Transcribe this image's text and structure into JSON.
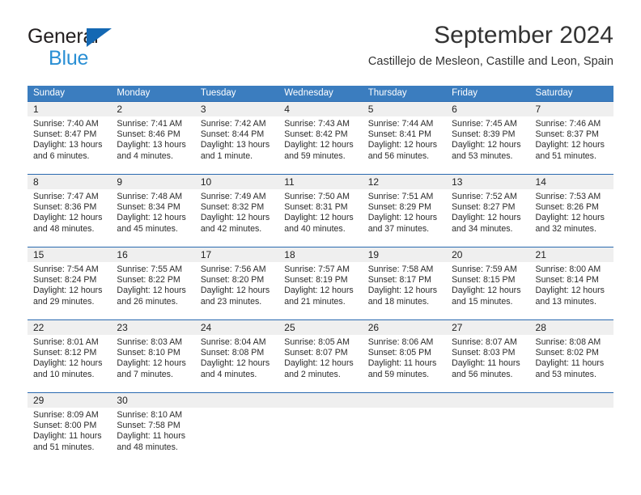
{
  "brand": {
    "line1": "General",
    "line2": "Blue",
    "triangle_color": "#1468b3",
    "line2_color": "#2a8fd4"
  },
  "header": {
    "title": "September 2024",
    "subtitle": "Castillejo de Mesleon, Castille and Leon, Spain"
  },
  "theme": {
    "header_bg": "#3b7dbf",
    "week_rule": "#2a6ab0",
    "daynum_band": "#efefef",
    "text": "#222222"
  },
  "weekdays": [
    "Sunday",
    "Monday",
    "Tuesday",
    "Wednesday",
    "Thursday",
    "Friday",
    "Saturday"
  ],
  "weeks": [
    {
      "days": [
        {
          "num": "1",
          "sunrise": "Sunrise: 7:40 AM",
          "sunset": "Sunset: 8:47 PM",
          "daylight_line1": "Daylight: 13 hours",
          "daylight_line2": "and 6 minutes."
        },
        {
          "num": "2",
          "sunrise": "Sunrise: 7:41 AM",
          "sunset": "Sunset: 8:46 PM",
          "daylight_line1": "Daylight: 13 hours",
          "daylight_line2": "and 4 minutes."
        },
        {
          "num": "3",
          "sunrise": "Sunrise: 7:42 AM",
          "sunset": "Sunset: 8:44 PM",
          "daylight_line1": "Daylight: 13 hours",
          "daylight_line2": "and 1 minute."
        },
        {
          "num": "4",
          "sunrise": "Sunrise: 7:43 AM",
          "sunset": "Sunset: 8:42 PM",
          "daylight_line1": "Daylight: 12 hours",
          "daylight_line2": "and 59 minutes."
        },
        {
          "num": "5",
          "sunrise": "Sunrise: 7:44 AM",
          "sunset": "Sunset: 8:41 PM",
          "daylight_line1": "Daylight: 12 hours",
          "daylight_line2": "and 56 minutes."
        },
        {
          "num": "6",
          "sunrise": "Sunrise: 7:45 AM",
          "sunset": "Sunset: 8:39 PM",
          "daylight_line1": "Daylight: 12 hours",
          "daylight_line2": "and 53 minutes."
        },
        {
          "num": "7",
          "sunrise": "Sunrise: 7:46 AM",
          "sunset": "Sunset: 8:37 PM",
          "daylight_line1": "Daylight: 12 hours",
          "daylight_line2": "and 51 minutes."
        }
      ]
    },
    {
      "days": [
        {
          "num": "8",
          "sunrise": "Sunrise: 7:47 AM",
          "sunset": "Sunset: 8:36 PM",
          "daylight_line1": "Daylight: 12 hours",
          "daylight_line2": "and 48 minutes."
        },
        {
          "num": "9",
          "sunrise": "Sunrise: 7:48 AM",
          "sunset": "Sunset: 8:34 PM",
          "daylight_line1": "Daylight: 12 hours",
          "daylight_line2": "and 45 minutes."
        },
        {
          "num": "10",
          "sunrise": "Sunrise: 7:49 AM",
          "sunset": "Sunset: 8:32 PM",
          "daylight_line1": "Daylight: 12 hours",
          "daylight_line2": "and 42 minutes."
        },
        {
          "num": "11",
          "sunrise": "Sunrise: 7:50 AM",
          "sunset": "Sunset: 8:31 PM",
          "daylight_line1": "Daylight: 12 hours",
          "daylight_line2": "and 40 minutes."
        },
        {
          "num": "12",
          "sunrise": "Sunrise: 7:51 AM",
          "sunset": "Sunset: 8:29 PM",
          "daylight_line1": "Daylight: 12 hours",
          "daylight_line2": "and 37 minutes."
        },
        {
          "num": "13",
          "sunrise": "Sunrise: 7:52 AM",
          "sunset": "Sunset: 8:27 PM",
          "daylight_line1": "Daylight: 12 hours",
          "daylight_line2": "and 34 minutes."
        },
        {
          "num": "14",
          "sunrise": "Sunrise: 7:53 AM",
          "sunset": "Sunset: 8:26 PM",
          "daylight_line1": "Daylight: 12 hours",
          "daylight_line2": "and 32 minutes."
        }
      ]
    },
    {
      "days": [
        {
          "num": "15",
          "sunrise": "Sunrise: 7:54 AM",
          "sunset": "Sunset: 8:24 PM",
          "daylight_line1": "Daylight: 12 hours",
          "daylight_line2": "and 29 minutes."
        },
        {
          "num": "16",
          "sunrise": "Sunrise: 7:55 AM",
          "sunset": "Sunset: 8:22 PM",
          "daylight_line1": "Daylight: 12 hours",
          "daylight_line2": "and 26 minutes."
        },
        {
          "num": "17",
          "sunrise": "Sunrise: 7:56 AM",
          "sunset": "Sunset: 8:20 PM",
          "daylight_line1": "Daylight: 12 hours",
          "daylight_line2": "and 23 minutes."
        },
        {
          "num": "18",
          "sunrise": "Sunrise: 7:57 AM",
          "sunset": "Sunset: 8:19 PM",
          "daylight_line1": "Daylight: 12 hours",
          "daylight_line2": "and 21 minutes."
        },
        {
          "num": "19",
          "sunrise": "Sunrise: 7:58 AM",
          "sunset": "Sunset: 8:17 PM",
          "daylight_line1": "Daylight: 12 hours",
          "daylight_line2": "and 18 minutes."
        },
        {
          "num": "20",
          "sunrise": "Sunrise: 7:59 AM",
          "sunset": "Sunset: 8:15 PM",
          "daylight_line1": "Daylight: 12 hours",
          "daylight_line2": "and 15 minutes."
        },
        {
          "num": "21",
          "sunrise": "Sunrise: 8:00 AM",
          "sunset": "Sunset: 8:14 PM",
          "daylight_line1": "Daylight: 12 hours",
          "daylight_line2": "and 13 minutes."
        }
      ]
    },
    {
      "days": [
        {
          "num": "22",
          "sunrise": "Sunrise: 8:01 AM",
          "sunset": "Sunset: 8:12 PM",
          "daylight_line1": "Daylight: 12 hours",
          "daylight_line2": "and 10 minutes."
        },
        {
          "num": "23",
          "sunrise": "Sunrise: 8:03 AM",
          "sunset": "Sunset: 8:10 PM",
          "daylight_line1": "Daylight: 12 hours",
          "daylight_line2": "and 7 minutes."
        },
        {
          "num": "24",
          "sunrise": "Sunrise: 8:04 AM",
          "sunset": "Sunset: 8:08 PM",
          "daylight_line1": "Daylight: 12 hours",
          "daylight_line2": "and 4 minutes."
        },
        {
          "num": "25",
          "sunrise": "Sunrise: 8:05 AM",
          "sunset": "Sunset: 8:07 PM",
          "daylight_line1": "Daylight: 12 hours",
          "daylight_line2": "and 2 minutes."
        },
        {
          "num": "26",
          "sunrise": "Sunrise: 8:06 AM",
          "sunset": "Sunset: 8:05 PM",
          "daylight_line1": "Daylight: 11 hours",
          "daylight_line2": "and 59 minutes."
        },
        {
          "num": "27",
          "sunrise": "Sunrise: 8:07 AM",
          "sunset": "Sunset: 8:03 PM",
          "daylight_line1": "Daylight: 11 hours",
          "daylight_line2": "and 56 minutes."
        },
        {
          "num": "28",
          "sunrise": "Sunrise: 8:08 AM",
          "sunset": "Sunset: 8:02 PM",
          "daylight_line1": "Daylight: 11 hours",
          "daylight_line2": "and 53 minutes."
        }
      ]
    },
    {
      "days": [
        {
          "num": "29",
          "sunrise": "Sunrise: 8:09 AM",
          "sunset": "Sunset: 8:00 PM",
          "daylight_line1": "Daylight: 11 hours",
          "daylight_line2": "and 51 minutes."
        },
        {
          "num": "30",
          "sunrise": "Sunrise: 8:10 AM",
          "sunset": "Sunset: 7:58 PM",
          "daylight_line1": "Daylight: 11 hours",
          "daylight_line2": "and 48 minutes."
        },
        {
          "num": "",
          "sunrise": "",
          "sunset": "",
          "daylight_line1": "",
          "daylight_line2": ""
        },
        {
          "num": "",
          "sunrise": "",
          "sunset": "",
          "daylight_line1": "",
          "daylight_line2": ""
        },
        {
          "num": "",
          "sunrise": "",
          "sunset": "",
          "daylight_line1": "",
          "daylight_line2": ""
        },
        {
          "num": "",
          "sunrise": "",
          "sunset": "",
          "daylight_line1": "",
          "daylight_line2": ""
        },
        {
          "num": "",
          "sunrise": "",
          "sunset": "",
          "daylight_line1": "",
          "daylight_line2": ""
        }
      ]
    }
  ]
}
